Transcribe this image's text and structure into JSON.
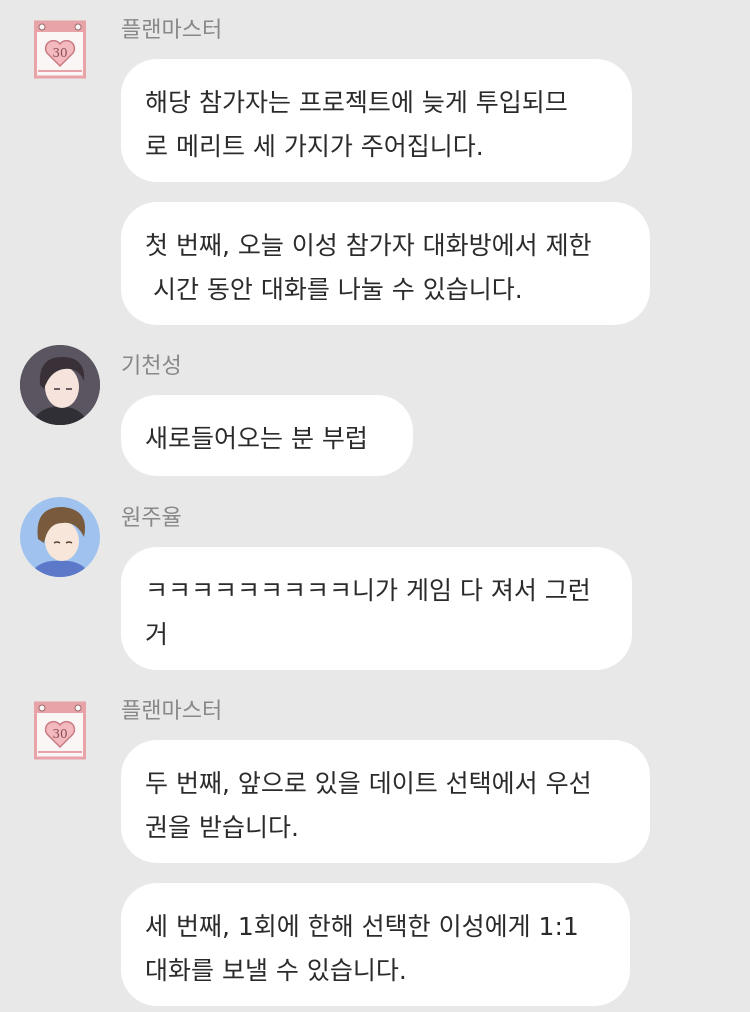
{
  "colors": {
    "background": "#e8e8e8",
    "bubble": "#ffffff",
    "name_text": "#888888",
    "message_text": "#2b2b2b",
    "calendar_pink": "#e8a3a8"
  },
  "calendar_icon": {
    "label": "30"
  },
  "messages": [
    {
      "sender": "플랜마스터",
      "avatar": "calendar-heart-icon",
      "bubbles": [
        "해당 참가자는 프로젝트에 늦게 투입되므\n로 메리트 세 가지가 주어집니다.",
        "첫 번째, 오늘 이성 참가자 대화방에서 제한\n 시간 동안 대화를 나눌 수 있습니다."
      ]
    },
    {
      "sender": "기천성",
      "avatar": "user-avatar-dark-hair",
      "bubbles": [
        "새로들어오는 분 부럽"
      ]
    },
    {
      "sender": "원주율",
      "avatar": "user-avatar-brown-hair",
      "bubbles": [
        "ㅋㅋㅋㅋㅋㅋㅋㅋㅋ니가 게임 다 져서 그런\n거"
      ]
    },
    {
      "sender": "플랜마스터",
      "avatar": "calendar-heart-icon",
      "bubbles": [
        "두 번째, 앞으로 있을 데이트 선택에서 우선\n권을 받습니다.",
        "세 번째, 1회에 한해 선택한 이성에게 1:1\n대화를 보낼 수 있습니다."
      ]
    }
  ]
}
